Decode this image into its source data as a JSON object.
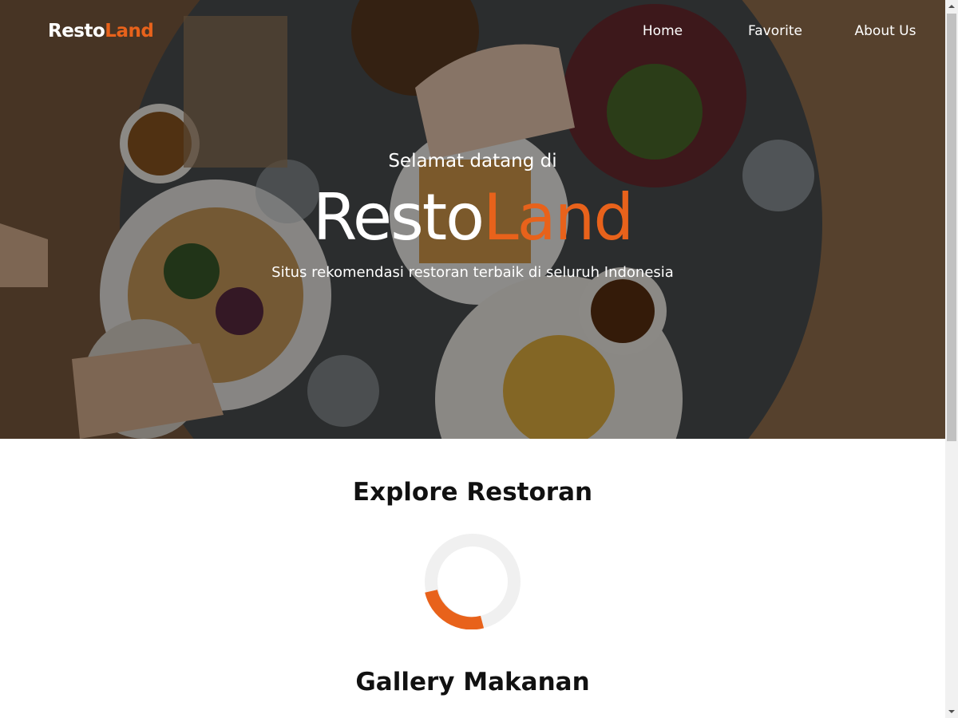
{
  "header": {
    "logo": {
      "part1": "Resto",
      "part2": "Land"
    },
    "nav": [
      {
        "label": "Home"
      },
      {
        "label": "Favorite"
      },
      {
        "label": "About Us"
      }
    ]
  },
  "hero": {
    "welcome": "Selamat datang di",
    "title_part1": "Resto",
    "title_part2": "Land",
    "tagline": "Situs rekomendasi restoran terbaik di seluruh Indonesia",
    "image": "restaurant-table-food-photo"
  },
  "main": {
    "explore_title": "Explore Restoran",
    "loading_indicator": "spinner-icon",
    "gallery_title": "Gallery Makanan"
  },
  "colors": {
    "accent": "#e8621b",
    "spinner_track": "#f0f0f0",
    "text_dark": "#111111"
  }
}
